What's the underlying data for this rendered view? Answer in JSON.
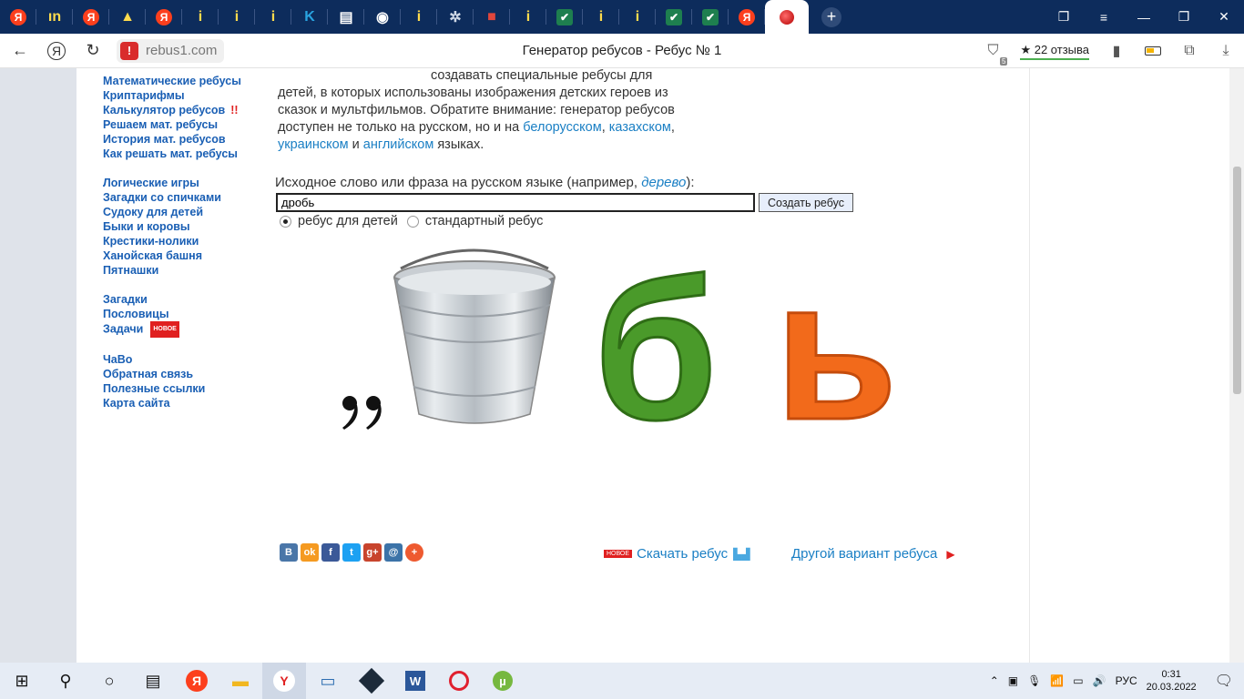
{
  "browser": {
    "tabs": [
      {
        "icon": "yandex-icon",
        "glyph": "Я",
        "style": "ya"
      },
      {
        "icon": "site-icon",
        "glyph": "ın",
        "style": "yel"
      },
      {
        "icon": "yandex-icon",
        "glyph": "Я",
        "style": "ya"
      },
      {
        "icon": "image-icon",
        "glyph": "▲",
        "style": "yel"
      },
      {
        "icon": "yandex-icon",
        "glyph": "Я",
        "style": "ya"
      },
      {
        "icon": "info-icon",
        "glyph": "i",
        "style": "yel"
      },
      {
        "icon": "info-icon",
        "glyph": "i",
        "style": "yel"
      },
      {
        "icon": "info-icon",
        "glyph": "i",
        "style": "yel"
      },
      {
        "icon": "k-icon",
        "glyph": "K",
        "style": "yel"
      },
      {
        "icon": "doc-icon",
        "glyph": "▤",
        "style": "yel"
      },
      {
        "icon": "shield-icon",
        "glyph": "◉",
        "style": "yel"
      },
      {
        "icon": "info-icon",
        "glyph": "i",
        "style": "yel"
      },
      {
        "icon": "atom-icon",
        "glyph": "✲",
        "style": "yel"
      },
      {
        "icon": "briefcase-icon",
        "glyph": "■",
        "style": "yel"
      },
      {
        "icon": "info-icon",
        "glyph": "i",
        "style": "yel"
      },
      {
        "icon": "check-icon",
        "glyph": "✔",
        "style": "yel"
      },
      {
        "icon": "info-icon",
        "glyph": "i",
        "style": "yel"
      },
      {
        "icon": "info-icon",
        "glyph": "i",
        "style": "yel"
      },
      {
        "icon": "check-icon",
        "glyph": "✔",
        "style": "yel"
      },
      {
        "icon": "check-icon",
        "glyph": "✔",
        "style": "yel"
      },
      {
        "icon": "yandex-icon",
        "glyph": "Я",
        "style": "ya"
      }
    ],
    "url": "rebus1.com",
    "page_title": "Генератор ребусов - Ребус № 1",
    "reviews": "★ 22 отзыва",
    "badge_count": "5"
  },
  "sidebar": {
    "group1": [
      "Математические ребусы",
      "Криптарифмы",
      "Калькулятор ребусов",
      "Решаем мат. ребусы",
      "История мат. ребусов",
      "Как решать мат. ребусы"
    ],
    "excl": "!!",
    "group2": [
      "Логические игры",
      "Загадки со спичками",
      "Судоку для детей",
      "Быки и коровы",
      "Крестики-нолики",
      "Ханойская башня",
      "Пятнашки"
    ],
    "group3": [
      "Загадки",
      "Пословицы",
      "Задачи"
    ],
    "new_badge": "НОВОЕ",
    "group4": [
      "ЧаВо",
      "Обратная связь",
      "Полезные ссылки",
      "Карта сайта"
    ]
  },
  "intro": {
    "line1": "создавать специальные ребусы для",
    "line2": "детей, в которых использованы изображения детских героев из",
    "line3": "сказок и мультфильмов. Обратите внимание: генератор ребусов",
    "line4_a": "доступен не только на русском, но и на ",
    "link_by": "белорусском",
    "sep1": ", ",
    "link_kz": "казахском",
    "sep2": ",",
    "link_ua": "украинском",
    "and": " и ",
    "link_en": "английском",
    "tail": " языках."
  },
  "form": {
    "label": "Исходное слово или фраза на русском языке (например, ",
    "example": "дерево",
    "label_end": "):",
    "value": "дробь",
    "button": "Создать ребус",
    "radio_kids": "ребус для детей",
    "radio_std": "стандартный ребус"
  },
  "rebus": {
    "comma": "’’",
    "letter1": "б",
    "letter2": "ь",
    "color1": "#4a9a2a",
    "color2": "#f26a1b"
  },
  "actions": {
    "new_badge": "НОВОЕ",
    "download": "Скачать ребус",
    "other": "Другой вариант ребуса"
  },
  "social": [
    {
      "icon": "vk-icon",
      "glyph": "В",
      "color": "#4a76a8"
    },
    {
      "icon": "ok-icon",
      "glyph": "ok",
      "color": "#f59a21"
    },
    {
      "icon": "facebook-icon",
      "glyph": "f",
      "color": "#3b5998"
    },
    {
      "icon": "twitter-icon",
      "glyph": "t",
      "color": "#1da1f2"
    },
    {
      "icon": "gplus-icon",
      "glyph": "g+",
      "color": "#c8442d"
    },
    {
      "icon": "mail-icon",
      "glyph": "@",
      "color": "#3c73a8"
    },
    {
      "icon": "more-icon",
      "glyph": "+",
      "color": "#ee5a30"
    }
  ],
  "taskbar": {
    "lang": "РУС",
    "time": "0:31",
    "date": "20.03.2022"
  }
}
